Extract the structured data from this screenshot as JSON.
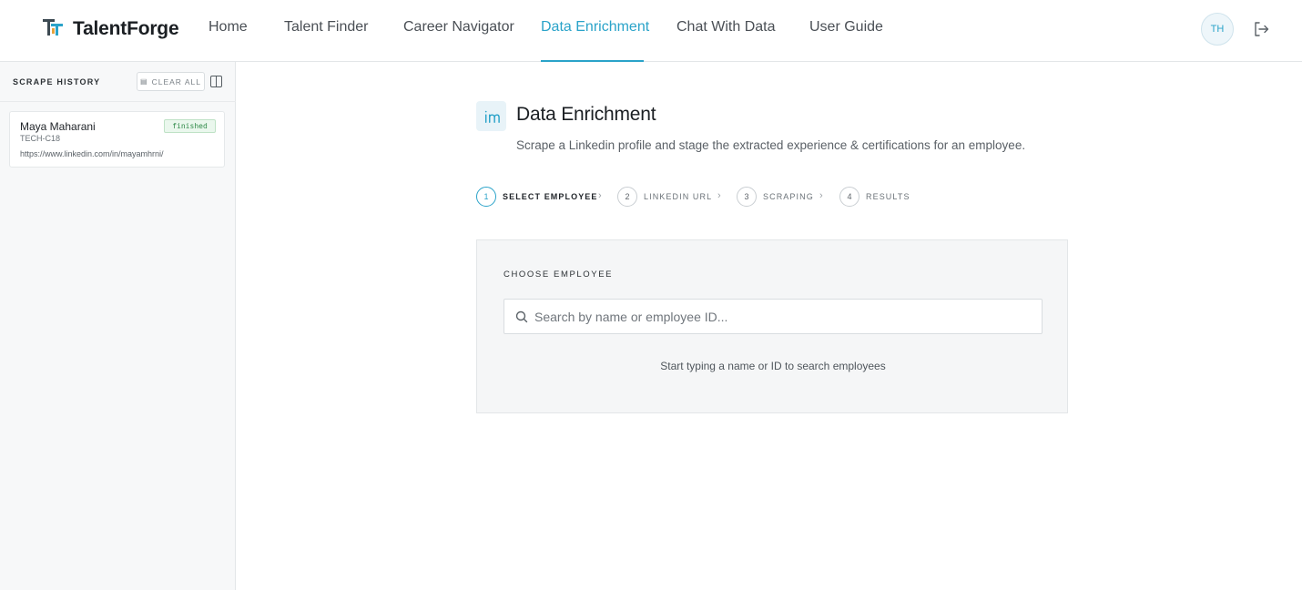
{
  "app": {
    "brand": "TalentForge",
    "accent_color": "#2aa3c9",
    "logo_icon": "talentforge-logo-icon"
  },
  "nav": {
    "items": [
      {
        "label": "Home",
        "active": false
      },
      {
        "label": "Talent Finder",
        "active": false
      },
      {
        "label": "Career Navigator",
        "active": false
      },
      {
        "label": "Data Enrichment",
        "active": true
      },
      {
        "label": "Chat With Data",
        "active": false
      },
      {
        "label": "User Guide",
        "active": false
      }
    ]
  },
  "user": {
    "initials": "TH",
    "logout_icon": "logout-icon"
  },
  "sidebar": {
    "title": "SCRAPE HISTORY",
    "clear_all_label": "CLEAR ALL",
    "clear_icon": "trash-icon",
    "toggle_icon": "panel-toggle-icon",
    "history": [
      {
        "name": "Maya Maharani",
        "employee_id": "TECH-C18",
        "url": "https://www.linkedin.com/in/mayamhrni/",
        "status": "finished",
        "status_color": "#2f8a48"
      }
    ]
  },
  "main": {
    "icon": "linkedin-icon",
    "title": "Data Enrichment",
    "subtitle": "Scrape a Linkedin profile and stage the extracted experience & certifications for an employee.",
    "steps": [
      {
        "number": "1",
        "label": "SELECT EMPLOYEE",
        "active": true
      },
      {
        "number": "2",
        "label": "LINKEDIN URL",
        "active": false
      },
      {
        "number": "3",
        "label": "SCRAPING",
        "active": false
      },
      {
        "number": "4",
        "label": "RESULTS",
        "active": false
      }
    ],
    "choose": {
      "label": "CHOOSE EMPLOYEE",
      "search_placeholder": "Search by name or employee ID...",
      "search_value": "",
      "hint": "Start typing a name or ID to search employees"
    }
  }
}
